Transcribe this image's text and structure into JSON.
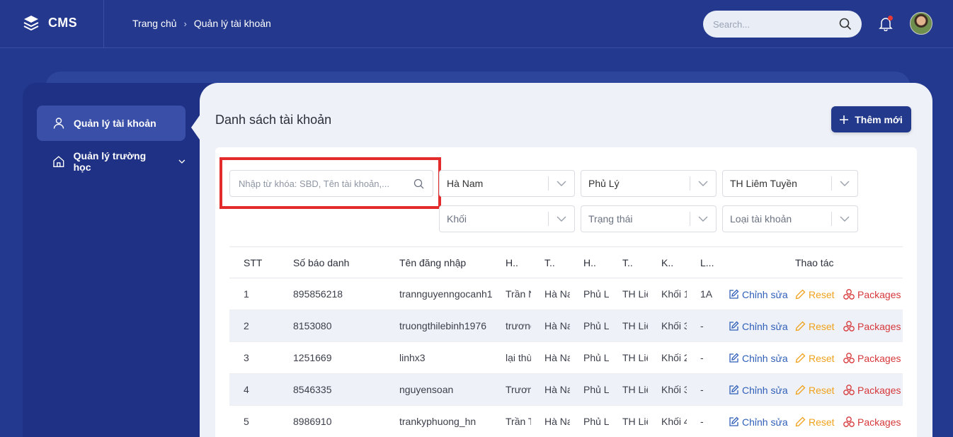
{
  "app": {
    "name": "CMS"
  },
  "breadcrumb": {
    "home": "Trang chủ",
    "separator": "›",
    "current": "Quản lý tài khoản"
  },
  "header_search": {
    "placeholder": "Search..."
  },
  "sidebar": {
    "items": [
      {
        "label": "Quản lý tài khoản",
        "icon": "user-icon",
        "active": true
      },
      {
        "label": "Quản lý trường học",
        "icon": "home-icon",
        "active": false
      }
    ]
  },
  "page": {
    "title": "Danh sách tài khoản",
    "add_button": "Thêm mới"
  },
  "filters": {
    "keyword_placeholder": "Nhập từ khóa: SBD, Tên tài khoản,...",
    "province": "Hà Nam",
    "district": "Phủ Lý",
    "school": "TH Liêm Tuyền",
    "grade_placeholder": "Khối",
    "status_placeholder": "Trạng thái",
    "account_type_placeholder": "Loại tài khoản"
  },
  "table": {
    "headers": [
      "STT",
      "Số báo danh",
      "Tên đăng nhập",
      "H..",
      "T..",
      "H..",
      "T..",
      "K..",
      "L...",
      "Thao tác"
    ],
    "actions": {
      "edit": "Chỉnh sửa",
      "reset": "Reset",
      "packages": "Packages"
    },
    "rows": [
      {
        "stt": "1",
        "sbd": "895856218",
        "username": "trannguyenngocanh1",
        "c4": "Trần N",
        "c5": "Hà Na",
        "c6": "Phủ L",
        "c7": "TH Liê",
        "c8": "Khối 1",
        "c9": "1A"
      },
      {
        "stt": "2",
        "sbd": "8153080",
        "username": "truongthilebinh1976",
        "c4": "trương",
        "c5": "Hà Na",
        "c6": "Phủ L",
        "c7": "TH Liê",
        "c8": "Khối 3",
        "c9": "-"
      },
      {
        "stt": "3",
        "sbd": "1251669",
        "username": "linhx3",
        "c4": "lại thù",
        "c5": "Hà Na",
        "c6": "Phủ L",
        "c7": "TH Liê",
        "c8": "Khối 2",
        "c9": "-"
      },
      {
        "stt": "4",
        "sbd": "8546335",
        "username": "nguyensoan",
        "c4": "Trươn",
        "c5": "Hà Na",
        "c6": "Phủ L",
        "c7": "TH Liê",
        "c8": "Khối 3",
        "c9": "-"
      },
      {
        "stt": "5",
        "sbd": "8986910",
        "username": "trankyphuong_hn",
        "c4": "Trần T",
        "c5": "Hà Na",
        "c6": "Phủ L",
        "c7": "TH Liê",
        "c8": "Khối 4",
        "c9": "-"
      }
    ]
  },
  "colors": {
    "navy": "#23398f",
    "accent": "#233a8c",
    "highlight": "#e32b2b",
    "edit": "#2f5fb8",
    "reset": "#f0a21a",
    "packages": "#d6383b"
  }
}
